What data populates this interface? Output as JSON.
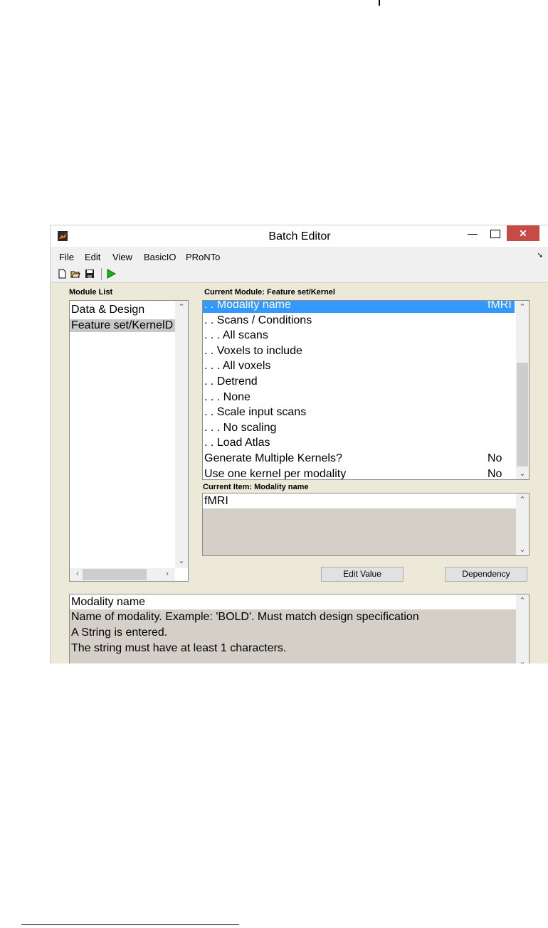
{
  "window": {
    "title": "Batch Editor",
    "min_glyph": "—",
    "close_glyph": "✕"
  },
  "menu": [
    "File",
    "Edit",
    "View",
    "BasicIO",
    "PRoNTo"
  ],
  "toolbar": {
    "icons": [
      "new-file-icon",
      "open-folder-icon",
      "save-icon",
      "run-icon"
    ]
  },
  "module_list": {
    "label": "Module List",
    "items": [
      "Data & Design",
      "Feature set/KernelD"
    ]
  },
  "current_module": {
    "label": "Current Module: Feature set/Kernel",
    "rows": [
      {
        "name": ". . Modality name",
        "value": "fMRI",
        "selected": true
      },
      {
        "name": ". . Scans / Conditions",
        "value": ""
      },
      {
        "name": ". . . All scans",
        "value": ""
      },
      {
        "name": ". . Voxels to include",
        "value": ""
      },
      {
        "name": ". . . All voxels",
        "value": ""
      },
      {
        "name": ". . Detrend",
        "value": ""
      },
      {
        "name": ". . . None",
        "value": ""
      },
      {
        "name": ". . Scale input scans",
        "value": ""
      },
      {
        "name": ". . . No scaling",
        "value": ""
      },
      {
        "name": ". . Load Atlas",
        "value": ""
      },
      {
        "name": "Generate Multiple Kernels?",
        "value": "No"
      },
      {
        "name": "Use one kernel per modality",
        "value": "No"
      }
    ]
  },
  "current_item": {
    "label": "Current Item: Modality name",
    "value": "fMRI"
  },
  "buttons": {
    "edit_value": "Edit Value",
    "dependency": "Dependency"
  },
  "help": {
    "lines": [
      "Modality name",
      "Name of modality. Example: 'BOLD'. Must match design specification",
      "A String is entered.",
      "The string must have at least 1 characters."
    ]
  },
  "colors": {
    "selection": "#3399ff",
    "frame": "#ece9d8",
    "close": "#c74a45",
    "highlight": "#d4d0c8"
  }
}
